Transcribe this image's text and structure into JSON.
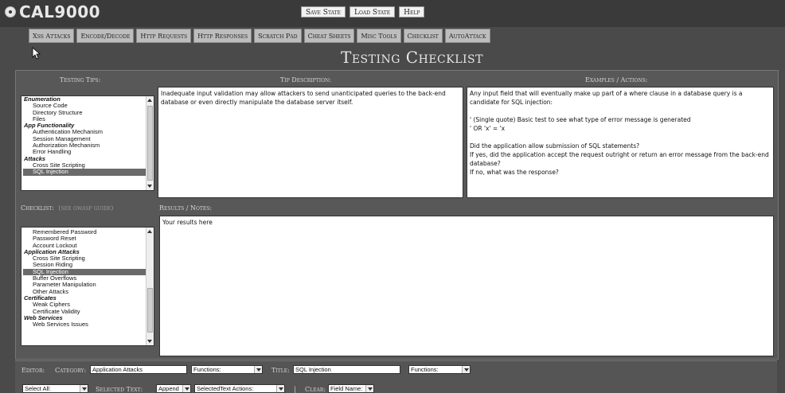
{
  "app": {
    "title": "CAL9000"
  },
  "toolbar": {
    "save_state": "Save State",
    "load_state": "Load State",
    "help": "Help"
  },
  "tabs": [
    {
      "label": "Xss Attacks"
    },
    {
      "label": "Encode/Decode"
    },
    {
      "label": "Http Requests"
    },
    {
      "label": "Http Responses"
    },
    {
      "label": "Scratch Pad"
    },
    {
      "label": "Cheat Sheets"
    },
    {
      "label": "Misc Tools"
    },
    {
      "label": "Checklist"
    },
    {
      "label": "AutoAttack"
    }
  ],
  "page": {
    "title": "Testing Checklist"
  },
  "headers": {
    "testing_tips": "Testing Tips:",
    "tip_description": "Tip Description:",
    "examples": "Examples / Actions:",
    "checklist": "Checklist:",
    "owasp_link": "(see owasp guide)",
    "results": "Results / Notes:"
  },
  "tips_list": [
    {
      "label": "Enumeration",
      "kind": "cat"
    },
    {
      "label": "Source Code",
      "kind": "sub"
    },
    {
      "label": "Directory Structure",
      "kind": "sub"
    },
    {
      "label": "Files",
      "kind": "sub"
    },
    {
      "label": "App Functionality",
      "kind": "cat"
    },
    {
      "label": "Authentication Mechanism",
      "kind": "sub"
    },
    {
      "label": "Session Management",
      "kind": "sub"
    },
    {
      "label": "Authorization Mechanism",
      "kind": "sub"
    },
    {
      "label": "Error Handling",
      "kind": "sub"
    },
    {
      "label": "Attacks",
      "kind": "cat"
    },
    {
      "label": "Cross Site Scripting",
      "kind": "sub"
    },
    {
      "label": "SQL Injection",
      "kind": "sub",
      "selected": true
    }
  ],
  "tip_description": "Inadequate input validation may allow attackers to send unanticipated queries to the back-end database or even directly manipulate the database server itself.",
  "examples": [
    "Any input field that will eventually make up part of a where clause in a database query is a candidate for SQL injection:",
    "",
    "' (Single quote) Basic test to see what type of error message is generated",
    "' OR 'x' = 'x",
    "",
    "Did the application allow submission of SQL statements?",
    "If yes, did the application accept the request outright or return an error message from the back-end database?",
    "If no, what was the response?"
  ],
  "checklist": [
    {
      "label": "Remembered Password",
      "kind": "sub"
    },
    {
      "label": "Password Reset",
      "kind": "sub"
    },
    {
      "label": "Account Lockout",
      "kind": "sub"
    },
    {
      "label": "Application Attacks",
      "kind": "cat"
    },
    {
      "label": "Cross Site Scripting",
      "kind": "sub"
    },
    {
      "label": "Session Riding",
      "kind": "sub"
    },
    {
      "label": "SQL Injection",
      "kind": "sub",
      "selected": true
    },
    {
      "label": "Buffer Overflows",
      "kind": "sub"
    },
    {
      "label": "Parameter Manipulation",
      "kind": "sub"
    },
    {
      "label": "Other Attacks",
      "kind": "sub"
    },
    {
      "label": "Certificates",
      "kind": "cat"
    },
    {
      "label": "Weak Ciphers",
      "kind": "sub"
    },
    {
      "label": "Certificate Validity",
      "kind": "sub"
    },
    {
      "label": "Web Services",
      "kind": "cat"
    },
    {
      "label": "Web Services Issues",
      "kind": "sub"
    }
  ],
  "results_placeholder": "Your results here",
  "editor": {
    "label": "Editor:",
    "category_label": "Category:",
    "category_value": "Application Attacks",
    "functions_1": "Functions:",
    "title_label": "Title:",
    "title_value": "SQL Injection",
    "functions_2": "Functions:"
  },
  "bottom_row": {
    "select_all": "Select All:",
    "selected_text_label": "Selected Text:",
    "append": "Append",
    "selected_actions": "SelectedText Actions:",
    "separator": "|",
    "clear_label": "Clear:",
    "field_name": "Field Name:"
  }
}
